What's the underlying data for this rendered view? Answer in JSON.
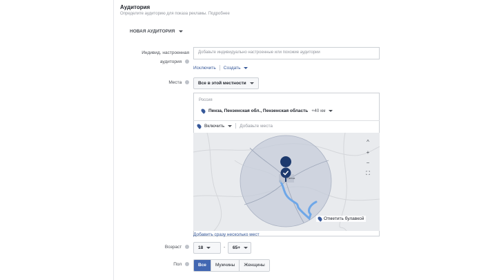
{
  "header": {
    "title": "Аудитория",
    "subtitle": "Определите аудиторию для показа рекламы. Подробнее"
  },
  "new_audience_label": "НОВАЯ АУДИТОРИЯ",
  "custom_audience": {
    "label_line1": "Индивид. настроенная",
    "label_line2": "аудитория",
    "placeholder": "Добавьте индивидуально настроенные или похожие аудитории",
    "exclude_link": "Исключить",
    "create_link": "Создать"
  },
  "locations": {
    "label": "Места",
    "dropdown_value": "Все в этой местности",
    "country": "Россия",
    "selected_location": "Пенза, Пензенская обл., Пензенская область",
    "radius": "+40 км",
    "include_dropdown": "Включить",
    "add_place_placeholder": "Добавьте места",
    "map_city_label": "Пенза",
    "drop_pin_label": "Отметить булавкой",
    "add_many_link": "Добавить сразу несколько мест"
  },
  "age": {
    "label": "Возраст",
    "min": "18",
    "max": "65+",
    "dash": "-"
  },
  "gender": {
    "label": "Пол",
    "options": [
      "Все",
      "Мужчины",
      "Женщины"
    ],
    "selected": "Все"
  },
  "map_controls": {
    "up": "^",
    "zoom_in": "+",
    "zoom_out": "−",
    "fullscreen": "⛶"
  },
  "colors": {
    "accent": "#4267b2",
    "link": "#365899",
    "radius_fill": "#c5ccd9",
    "river": "#6ea7e8"
  }
}
